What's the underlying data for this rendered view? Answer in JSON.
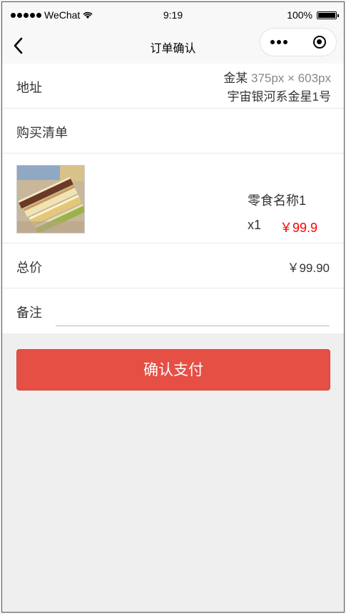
{
  "status_bar": {
    "carrier": "WeChat",
    "time": "9:19",
    "battery": "100%"
  },
  "nav": {
    "title": "订单确认",
    "icons": [
      "back-icon",
      "more-icon",
      "record-icon"
    ]
  },
  "address": {
    "label": "地址",
    "name": "金某",
    "overlay": "375px × 603px",
    "detail": "宇宙银河系金星1号"
  },
  "cart": {
    "label": "购买清单",
    "items": [
      {
        "name": "零食名称1",
        "quantity": "x1",
        "price": "￥99.9"
      }
    ]
  },
  "total": {
    "label": "总价",
    "value": "￥99.90"
  },
  "remark": {
    "label": "备注",
    "value": "",
    "placeholder": ""
  },
  "pay_button": "确认支付",
  "colors": {
    "accent": "#e64f44",
    "price": "#ff0000",
    "background": "#efefef"
  }
}
